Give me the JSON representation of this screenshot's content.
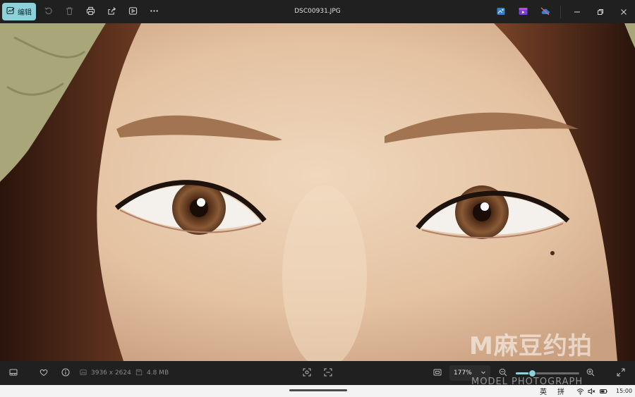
{
  "toolbar": {
    "edit_label": "编辑",
    "title": "DSC00931.JPG"
  },
  "bottom": {
    "dimensions": "3936 x 2624",
    "file_size": "4.8 MB",
    "zoom_level": "177%",
    "zoom_slider_fraction": 0.25
  },
  "taskbar": {
    "ime_lang": "英",
    "ime_mode": "拼",
    "time": "15:00"
  },
  "watermark": {
    "brand": "M麻豆约拍",
    "sub": "MODEL PHOTOGRAPH"
  },
  "colors": {
    "accent": "#8fd1d8",
    "toolbar_bg": "#202020",
    "taskbar_bg": "#f3f3f3"
  },
  "icons": {
    "edit": "edit-image-icon",
    "rotate": "rotate-icon",
    "delete": "delete-icon",
    "print": "print-icon",
    "share": "share-icon",
    "slideshow": "slideshow-icon",
    "more": "more-icon"
  }
}
